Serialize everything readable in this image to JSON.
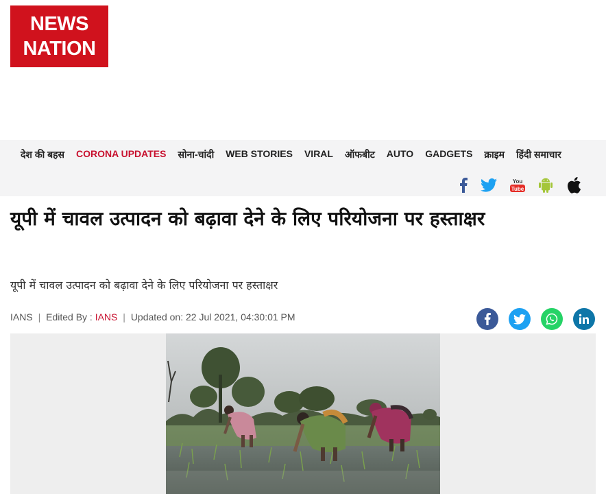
{
  "logo": {
    "line1": "NEWS",
    "line2": "NATION"
  },
  "nav": {
    "items": [
      {
        "label": "देश की बहस",
        "highlight": false
      },
      {
        "label": "CORONA UPDATES",
        "highlight": true
      },
      {
        "label": "सोना-चांदी",
        "highlight": false
      },
      {
        "label": "WEB STORIES",
        "highlight": false
      },
      {
        "label": "VIRAL",
        "highlight": false
      },
      {
        "label": "ऑफबीट",
        "highlight": false
      },
      {
        "label": "AUTO",
        "highlight": false
      },
      {
        "label": "GADGETS",
        "highlight": false
      },
      {
        "label": "क्राइम",
        "highlight": false
      },
      {
        "label": "हिंदी समाचार",
        "highlight": false
      }
    ],
    "social_icons": [
      "facebook-icon",
      "twitter-icon",
      "youtube-icon",
      "android-icon",
      "apple-icon"
    ]
  },
  "article": {
    "headline": "यूपी में चावल उत्पादन को बढ़ावा देने के लिए परियोजना पर हस्ताक्षर",
    "summary": "यूपी में चावल उत्पादन को बढ़ावा देने के लिए परियोजना पर हस्ताक्षर",
    "meta": {
      "source": "IANS",
      "edited_by_label": "Edited By :",
      "editor": "IANS",
      "updated_label": "Updated on:",
      "updated_value": "22 Jul 2021, 04:30:01 PM"
    },
    "share_icons": [
      "facebook-share-icon",
      "twitter-share-icon",
      "whatsapp-share-icon",
      "linkedin-share-icon"
    ]
  },
  "colors": {
    "brand_red": "#d0121d",
    "facebook": "#3b5998",
    "twitter": "#1da1f2",
    "whatsapp": "#25d366",
    "linkedin": "#0e76a8",
    "youtube": "#e52d27",
    "android": "#a4c639"
  }
}
